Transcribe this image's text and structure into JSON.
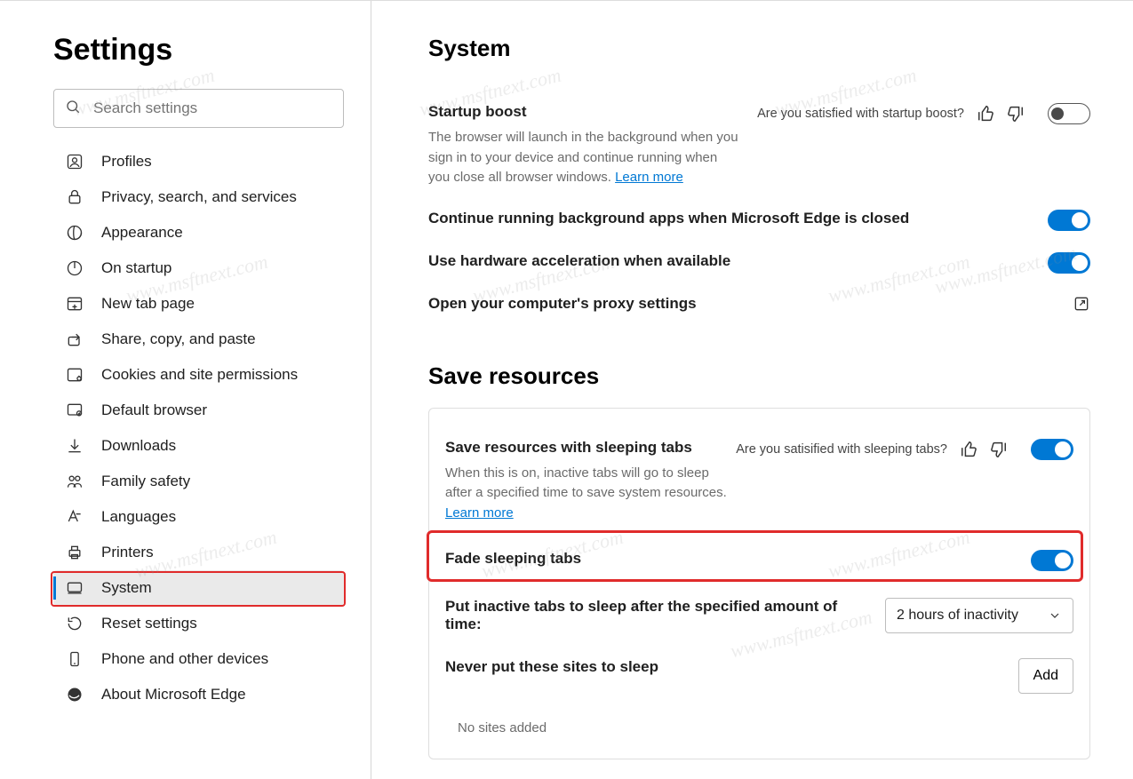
{
  "sidebar": {
    "title": "Settings",
    "search_placeholder": "Search settings",
    "items": [
      {
        "label": "Profiles",
        "icon": "profile-icon"
      },
      {
        "label": "Privacy, search, and services",
        "icon": "lock-icon"
      },
      {
        "label": "Appearance",
        "icon": "appearance-icon"
      },
      {
        "label": "On startup",
        "icon": "power-icon"
      },
      {
        "label": "New tab page",
        "icon": "newtab-icon"
      },
      {
        "label": "Share, copy, and paste",
        "icon": "share-icon"
      },
      {
        "label": "Cookies and site permissions",
        "icon": "cookies-icon"
      },
      {
        "label": "Default browser",
        "icon": "default-browser-icon"
      },
      {
        "label": "Downloads",
        "icon": "download-icon"
      },
      {
        "label": "Family safety",
        "icon": "family-icon"
      },
      {
        "label": "Languages",
        "icon": "language-icon"
      },
      {
        "label": "Printers",
        "icon": "printer-icon"
      },
      {
        "label": "System",
        "icon": "system-icon",
        "active": true
      },
      {
        "label": "Reset settings",
        "icon": "reset-icon"
      },
      {
        "label": "Phone and other devices",
        "icon": "phone-icon"
      },
      {
        "label": "About Microsoft Edge",
        "icon": "edge-icon"
      }
    ]
  },
  "main": {
    "title": "System",
    "startup": {
      "title": "Startup boost",
      "desc_a": "The browser will launch in the background when you sign in to your device and continue running when you close all browser windows. ",
      "learn_more": "Learn more",
      "feedback_q": "Are you satisfied with startup boost?"
    },
    "background_apps": {
      "title": "Continue running background apps when Microsoft Edge is closed"
    },
    "hw_accel": {
      "title": "Use hardware acceleration when available"
    },
    "proxy": {
      "title": "Open your computer's proxy settings"
    },
    "save_resources_heading": "Save resources",
    "sleeping": {
      "title": "Save resources with sleeping tabs",
      "desc_a": "When this is on, inactive tabs will go to sleep after a specified time to save system resources. ",
      "learn_more": "Learn more",
      "feedback_q": "Are you satisified with sleeping tabs?"
    },
    "fade": {
      "title": "Fade sleeping tabs"
    },
    "inactive": {
      "title": "Put inactive tabs to sleep after the specified amount of time:",
      "dropdown_value": "2 hours of inactivity"
    },
    "never_sleep": {
      "title": "Never put these sites to sleep",
      "add_label": "Add",
      "empty": "No sites added"
    }
  },
  "watermark": "www.msftnext.com"
}
